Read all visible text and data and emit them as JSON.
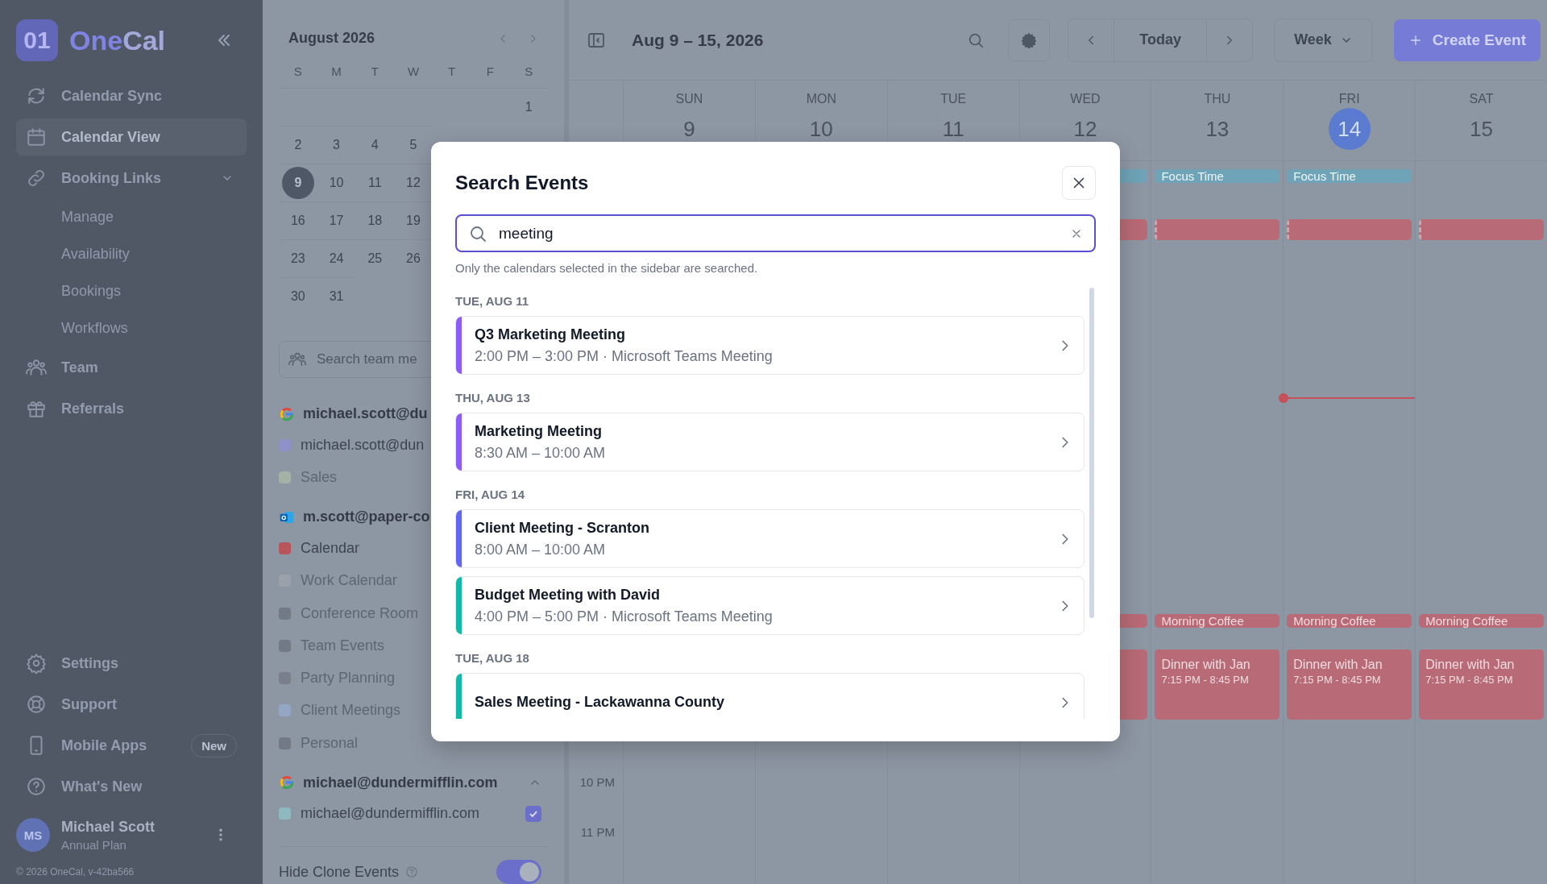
{
  "sidebar": {
    "logo": {
      "mark": "01",
      "name": [
        "One",
        "Cal"
      ]
    },
    "nav": [
      {
        "label": "Calendar Sync",
        "selected": false
      },
      {
        "label": "Calendar View",
        "selected": true
      },
      {
        "label": "Booking Links",
        "selected": false,
        "expanded": true,
        "children": [
          {
            "label": "Manage"
          },
          {
            "label": "Availability"
          },
          {
            "label": "Bookings"
          },
          {
            "label": "Workflows"
          }
        ]
      },
      {
        "label": "Team",
        "selected": false
      },
      {
        "label": "Referrals",
        "selected": false
      }
    ],
    "bottom_nav": [
      {
        "label": "Settings"
      },
      {
        "label": "Support"
      },
      {
        "label": "Mobile Apps",
        "badge": "New"
      },
      {
        "label": "What's New"
      }
    ],
    "user": {
      "initials": "MS",
      "name": "Michael Scott",
      "plan": "Annual Plan"
    },
    "footer": "© 2026 OneCal, v-42ba566"
  },
  "mini_calendar": {
    "month": "August 2026",
    "weekdays": [
      "S",
      "M",
      "T",
      "W",
      "T",
      "F",
      "S"
    ],
    "weeks": [
      [
        {
          "kind": "blank"
        },
        {
          "kind": "blank"
        },
        {
          "kind": "blank"
        },
        {
          "kind": "blank"
        },
        {
          "kind": "blank"
        },
        {
          "kind": "blank"
        },
        {
          "kind": "day",
          "d": "1",
          "selected": false
        }
      ],
      [
        {
          "kind": "day",
          "d": "2",
          "selected": false
        },
        {
          "kind": "day",
          "d": "3",
          "selected": false
        },
        {
          "kind": "day",
          "d": "4",
          "selected": false
        },
        {
          "kind": "day",
          "d": "5",
          "selected": false
        }
      ],
      [
        {
          "kind": "day",
          "d": "9",
          "selected": true
        },
        {
          "kind": "day",
          "d": "10",
          "selected": false
        },
        {
          "kind": "day",
          "d": "11",
          "selected": false
        },
        {
          "kind": "day",
          "d": "12",
          "selected": false
        }
      ],
      [
        {
          "kind": "day",
          "d": "16",
          "selected": false
        },
        {
          "kind": "day",
          "d": "17",
          "selected": false
        },
        {
          "kind": "day",
          "d": "18",
          "selected": false
        },
        {
          "kind": "day",
          "d": "19",
          "selected": false
        }
      ],
      [
        {
          "kind": "day",
          "d": "23",
          "selected": false
        },
        {
          "kind": "day",
          "d": "24",
          "selected": false
        },
        {
          "kind": "day",
          "d": "25",
          "selected": false
        },
        {
          "kind": "day",
          "d": "26",
          "selected": false
        }
      ],
      [
        {
          "kind": "day",
          "d": "30",
          "selected": false
        },
        {
          "kind": "day",
          "d": "31",
          "selected": false
        }
      ]
    ]
  },
  "team_search": {
    "placeholder": "Search team me"
  },
  "accounts": [
    {
      "kind": "google",
      "name": "michael.scott@du",
      "calendars": [
        {
          "name": "michael.scott@dun",
          "color": "#8e90c8",
          "checked": true
        },
        {
          "name": "Sales",
          "color": "#a3b2a4",
          "checked": false
        }
      ]
    },
    {
      "kind": "outlook",
      "name": "m.scott@paper-co",
      "calendars": [
        {
          "name": "Calendar",
          "color": "#b8545c",
          "checked": true
        },
        {
          "name": "Work Calendar",
          "color": "#9ba1aa",
          "checked": false
        },
        {
          "name": "Conference Room",
          "color": "#727a86",
          "checked": false
        },
        {
          "name": "Team Events",
          "color": "#727a86",
          "checked": false
        },
        {
          "name": "Party Planning",
          "color": "#79808b",
          "checked": false
        },
        {
          "name": "Client Meetings",
          "color": "#93a6c6",
          "checked": false
        },
        {
          "name": "Personal",
          "color": "#727a86",
          "checked": false
        }
      ]
    },
    {
      "kind": "google",
      "name": "michael@dundermifflin.com",
      "expanded": true,
      "calendars": [
        {
          "name": "michael@dundermifflin.com",
          "color": "#8fb9c0",
          "checked": true
        }
      ]
    }
  ],
  "hide_clone": {
    "label": "Hide Clone Events",
    "on": true
  },
  "toolbar": {
    "range": "Aug 9 – 15, 2026",
    "today": "Today",
    "view": "Week",
    "create": "Create Event"
  },
  "week": {
    "days": [
      {
        "name": "SUN",
        "date": "9",
        "today": false
      },
      {
        "name": "MON",
        "date": "10",
        "today": false
      },
      {
        "name": "TUE",
        "date": "11",
        "today": false
      },
      {
        "name": "WED",
        "date": "12",
        "today": false,
        "events": [
          {
            "kind": "focus"
          },
          {
            "kind": "busy"
          },
          {
            "kind": "coffee"
          },
          {
            "kind": "dinner"
          }
        ]
      },
      {
        "name": "THU",
        "date": "13",
        "today": false,
        "events": [
          {
            "kind": "focus",
            "title": "Focus Time"
          },
          {
            "kind": "busy"
          },
          {
            "kind": "coffee",
            "title": "Morning Coffee"
          },
          {
            "kind": "dinner",
            "title": "Dinner with Jan",
            "time": "7:15 PM - 8:45 PM"
          }
        ]
      },
      {
        "name": "FRI",
        "date": "14",
        "today": true,
        "events": [
          {
            "kind": "focus",
            "title": "Focus Time"
          },
          {
            "kind": "busy"
          },
          {
            "kind": "coffee",
            "title": "Morning Coffee"
          },
          {
            "kind": "dinner",
            "title": "Dinner with Jan",
            "time": "7:15 PM - 8:45 PM"
          }
        ]
      },
      {
        "name": "SAT",
        "date": "15",
        "today": false,
        "events": [
          {
            "kind": "busy"
          },
          {
            "kind": "coffee",
            "title": "Morning Coffee"
          },
          {
            "kind": "dinner",
            "title": "Dinner with Jan",
            "time": "7:15 PM - 8:45 PM"
          }
        ]
      }
    ],
    "hours": [
      "10 PM",
      "11 PM"
    ]
  },
  "dialog": {
    "title": "Search Events",
    "query": "meeting",
    "hint": "Only the calendars selected in the sidebar are searched.",
    "groups": [
      {
        "date": "TUE, AUG 11",
        "results": [
          {
            "title": "Q3 Marketing Meeting",
            "detail": "2:00 PM – 3:00 PM · Microsoft Teams Meeting",
            "color": "#8b5cf6"
          }
        ]
      },
      {
        "date": "THU, AUG 13",
        "results": [
          {
            "title": "Marketing Meeting",
            "detail": "8:30 AM – 10:00 AM",
            "color": "#8b5cf6"
          }
        ]
      },
      {
        "date": "FRI, AUG 14",
        "results": [
          {
            "title": "Client Meeting - Scranton",
            "detail": "8:00 AM – 10:00 AM",
            "color": "#6366f1"
          },
          {
            "title": "Budget Meeting with David",
            "detail": "4:00 PM – 5:00 PM · Microsoft Teams Meeting",
            "color": "#14b8a6"
          }
        ]
      },
      {
        "date": "TUE, AUG 18",
        "results": [
          {
            "title": "Sales Meeting - Lackawanna County",
            "color": "#14b8a6"
          }
        ]
      }
    ]
  }
}
